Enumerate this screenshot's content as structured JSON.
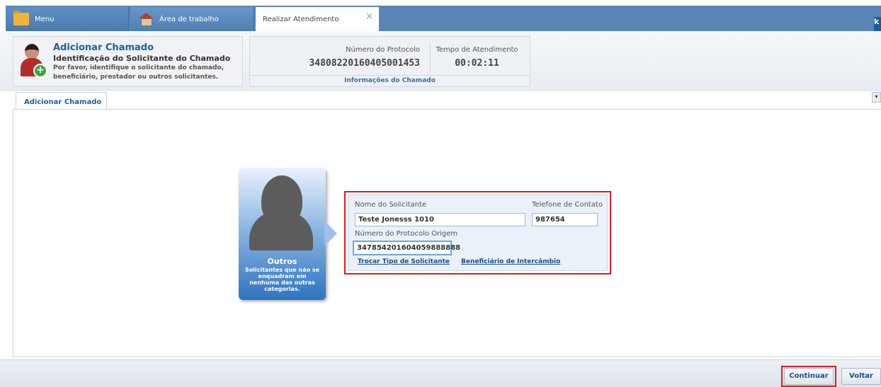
{
  "tabs": {
    "menu": "Menu",
    "area": "Área de trabalho",
    "active": "Realizar Atendimento",
    "close_glyph": "×"
  },
  "corner_glyph": "k",
  "header": {
    "title": "Adicionar Chamado",
    "subtitle": "Identificação do Solicitante do Chamado",
    "description": "Por favor, identifique o solicitante do chamado, beneficiário, prestador ou outros solicitantes.",
    "protocol_label": "Número do Protocolo",
    "protocol_value": "34808220160405001453",
    "time_label": "Tempo de Atendimento",
    "time_value": "00:02:11",
    "info_footer": "Informações do Chamado"
  },
  "content_tab": "Adicionar Chamado",
  "scroll_glyph": "▾",
  "card": {
    "title": "Outros",
    "description": "Solicitantes que não se enquadram em nenhuma das outras categorias."
  },
  "form": {
    "name_label": "Nome do Solicitante",
    "name_value": "Teste Jonesss 1010",
    "phone_label": "Telefone de Contato",
    "phone_value": "987654",
    "origin_label": "Número do Protocolo Origem",
    "origin_value": "347854201604059888888",
    "link_change": "Trocar Tipo de Solicitante",
    "link_exchange": "Beneficiário de Intercâmbio"
  },
  "footer": {
    "continue": "Continuar",
    "back": "Voltar"
  },
  "colors": {
    "accent": "#1d5fa0",
    "tabbar": "#5a86b6",
    "highlight": "#d61e1e"
  }
}
